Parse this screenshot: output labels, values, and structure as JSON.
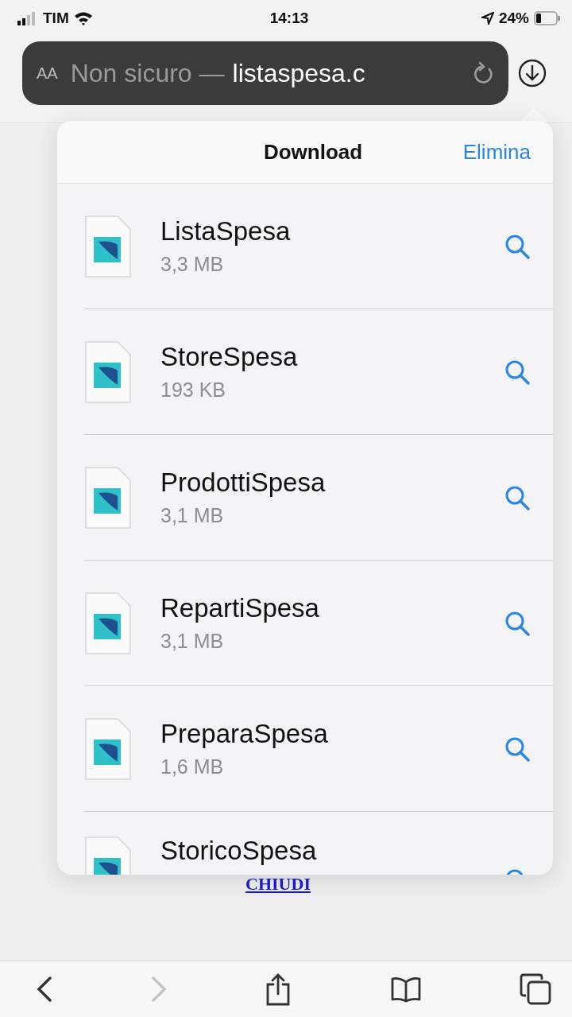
{
  "status_bar": {
    "carrier": "TIM",
    "time": "14:13",
    "battery": "24%"
  },
  "address_bar": {
    "text_size": "AA",
    "security": "Non sicuro —",
    "host": "listaspesa.c"
  },
  "page": {
    "link": "CHIUDI"
  },
  "downloads": {
    "title": "Download",
    "action": "Elimina",
    "files": [
      {
        "name": "ListaSpesa",
        "size": "3,3 MB"
      },
      {
        "name": "StoreSpesa",
        "size": "193 KB"
      },
      {
        "name": "ProdottiSpesa",
        "size": "3,1 MB"
      },
      {
        "name": "RepartiSpesa",
        "size": "3,1 MB"
      },
      {
        "name": "PreparaSpesa",
        "size": "1,6 MB"
      },
      {
        "name": "StoricoSpesa"
      }
    ]
  },
  "toolbar": [
    {
      "kind": "back",
      "disabled": false
    },
    {
      "kind": "forward",
      "disabled": true
    },
    {
      "kind": "share",
      "disabled": false
    },
    {
      "kind": "bookmarks",
      "disabled": false
    },
    {
      "kind": "tabs",
      "disabled": false
    }
  ]
}
